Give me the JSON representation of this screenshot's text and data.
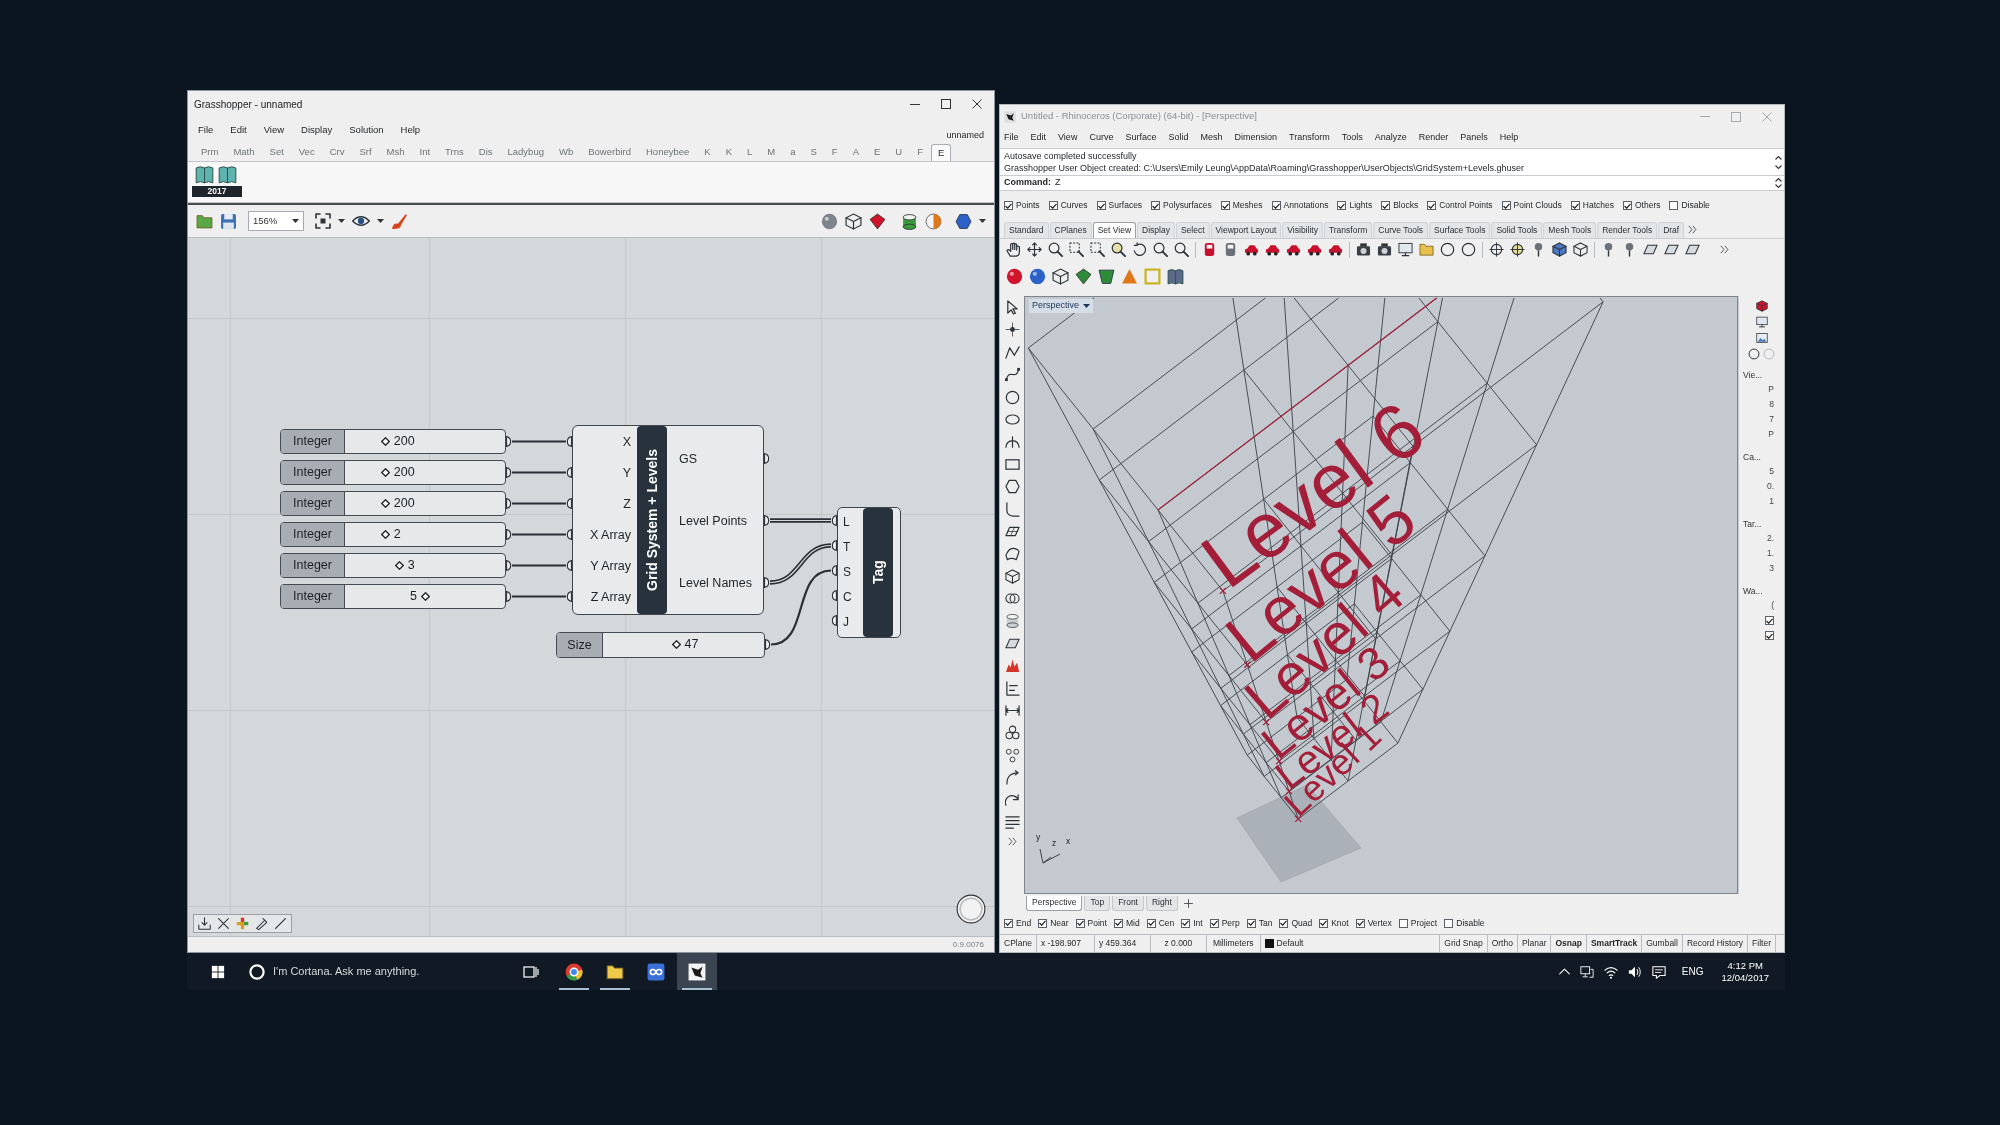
{
  "grasshopper": {
    "title": "Grasshopper - unnamed",
    "active": true,
    "menu": [
      "File",
      "Edit",
      "View",
      "Display",
      "Solution",
      "Help"
    ],
    "document": "unnamed",
    "tabs": [
      {
        "label": "Prm",
        "selected": false
      },
      {
        "label": "Math",
        "selected": false
      },
      {
        "label": "Set",
        "selected": false
      },
      {
        "label": "Vec",
        "selected": false
      },
      {
        "label": "Crv",
        "selected": false
      },
      {
        "label": "Srf",
        "selected": false
      },
      {
        "label": "Msh",
        "selected": false
      },
      {
        "label": "Int",
        "selected": false
      },
      {
        "label": "Trns",
        "selected": false
      },
      {
        "label": "Dis",
        "selected": false
      },
      {
        "label": "Ladybug",
        "selected": false
      },
      {
        "label": "Wb",
        "selected": false
      },
      {
        "label": "Bowerbird",
        "selected": false
      },
      {
        "label": "Honeybee",
        "selected": false
      },
      {
        "label": "K",
        "selected": false
      },
      {
        "label": "K",
        "selected": false
      },
      {
        "label": "L",
        "selected": false
      },
      {
        "label": "M",
        "selected": false
      },
      {
        "label": "a",
        "selected": false
      },
      {
        "label": "S",
        "selected": false
      },
      {
        "label": "F",
        "selected": false
      },
      {
        "label": "A",
        "selected": false
      },
      {
        "label": "E",
        "selected": false
      },
      {
        "label": "U",
        "selected": false
      },
      {
        "label": "F",
        "selected": false
      },
      {
        "label": "E",
        "selected": true
      }
    ],
    "ribbon_badge": "2017",
    "zoom": "156%",
    "sliders": [
      {
        "label": "Integer",
        "value": "200",
        "level": 0.22
      },
      {
        "label": "Integer",
        "value": "200",
        "level": 0.22
      },
      {
        "label": "Integer",
        "value": "200",
        "level": 0.22
      },
      {
        "label": "Integer",
        "value": "2",
        "level": 0.22
      },
      {
        "label": "Integer",
        "value": "3",
        "level": 0.32
      },
      {
        "label": "Integer",
        "value": "5",
        "level": 0.5
      }
    ],
    "component": {
      "title": "Grid System + Levels",
      "inputs": [
        "X",
        "Y",
        "Z",
        "X Array",
        "Y Array",
        "Z Array"
      ],
      "outputs": [
        "GS",
        "Level Points",
        "Level Names"
      ]
    },
    "size_slider": {
      "label": "Size",
      "value": "47",
      "level": 0.45
    },
    "tag": {
      "title": "Tag",
      "inputs": [
        "L",
        "T",
        "S",
        "C",
        "J"
      ]
    },
    "version": "0.9.0076"
  },
  "rhino": {
    "title": "Untitled - Rhinoceros (Corporate) (64-bit) - [Perspective]",
    "active": false,
    "menu": [
      "File",
      "Edit",
      "View",
      "Curve",
      "Surface",
      "Solid",
      "Mesh",
      "Dimension",
      "Transform",
      "Tools",
      "Analyze",
      "Render",
      "Panels",
      "Help"
    ],
    "history": [
      "Autosave completed successfully",
      "Grasshopper User Object created: C:\\Users\\Emily Leung\\AppData\\Roaming\\Grasshopper\\UserObjects\\GridSystem+Levels.ghuser"
    ],
    "command": {
      "label": "Command:",
      "value": "Z"
    },
    "filters": [
      {
        "label": "Points",
        "checked": true
      },
      {
        "label": "Curves",
        "checked": true
      },
      {
        "label": "Surfaces",
        "checked": true
      },
      {
        "label": "Polysurfaces",
        "checked": true
      },
      {
        "label": "Meshes",
        "checked": true
      },
      {
        "label": "Annotations",
        "checked": true
      },
      {
        "label": "Lights",
        "checked": true
      },
      {
        "label": "Blocks",
        "checked": true
      },
      {
        "label": "Control Points",
        "checked": true
      },
      {
        "label": "Point Clouds",
        "checked": true
      },
      {
        "label": "Hatches",
        "checked": true
      },
      {
        "label": "Others",
        "checked": true
      },
      {
        "label": "Disable",
        "checked": false
      }
    ],
    "toolbar_tabs": [
      {
        "label": "Standard",
        "selected": false
      },
      {
        "label": "CPlanes",
        "selected": false
      },
      {
        "label": "Set View",
        "selected": true
      },
      {
        "label": "Display",
        "selected": false
      },
      {
        "label": "Select",
        "selected": false
      },
      {
        "label": "Viewport Layout",
        "selected": false
      },
      {
        "label": "Visibility",
        "selected": false
      },
      {
        "label": "Transform",
        "selected": false
      },
      {
        "label": "Curve Tools",
        "selected": false
      },
      {
        "label": "Surface Tools",
        "selected": false
      },
      {
        "label": "Solid Tools",
        "selected": false
      },
      {
        "label": "Mesh Tools",
        "selected": false
      },
      {
        "label": "Render Tools",
        "selected": false
      },
      {
        "label": "Draf",
        "selected": false
      }
    ],
    "viewport": {
      "label": "Perspective",
      "levels": [
        "Level 6",
        "Level 5",
        "Level 4",
        "Level 3",
        "Level 2",
        "Level 1"
      ],
      "axes": [
        "y",
        "z",
        "x"
      ]
    },
    "properties_panel": [
      {
        "label": "Vie...",
        "values": [
          "P",
          "8",
          "7",
          "P"
        ]
      },
      {
        "label": "Ca...",
        "values": [
          "5",
          "0.",
          "1"
        ]
      },
      {
        "label": "Tar...",
        "values": [
          "2.",
          "1.",
          "3"
        ]
      },
      {
        "label": "Wa...",
        "values": [
          "("
        ],
        "checks": [
          true,
          true
        ]
      }
    ],
    "viewport_tabs": [
      {
        "label": "Perspective",
        "selected": true
      },
      {
        "label": "Top",
        "selected": false
      },
      {
        "label": "Front",
        "selected": false
      },
      {
        "label": "Right",
        "selected": false
      }
    ],
    "osnaps": [
      {
        "label": "End",
        "checked": true
      },
      {
        "label": "Near",
        "checked": true
      },
      {
        "label": "Point",
        "checked": true
      },
      {
        "label": "Mid",
        "checked": true
      },
      {
        "label": "Cen",
        "checked": true
      },
      {
        "label": "Int",
        "checked": true
      },
      {
        "label": "Perp",
        "checked": true
      },
      {
        "label": "Tan",
        "checked": true
      },
      {
        "label": "Quad",
        "checked": true
      },
      {
        "label": "Knot",
        "checked": true
      },
      {
        "label": "Vertex",
        "checked": true
      },
      {
        "label": "Project",
        "checked": false
      },
      {
        "label": "Disable",
        "checked": false
      }
    ],
    "status": {
      "cplane": "CPlane",
      "x": "x -198.907",
      "y": "y 459.364",
      "z": "z 0.000",
      "units": "Millimeters",
      "layer": "Default",
      "toggles": [
        {
          "label": "Grid Snap",
          "on": false
        },
        {
          "label": "Ortho",
          "on": false
        },
        {
          "label": "Planar",
          "on": false
        },
        {
          "label": "Osnap",
          "on": true
        },
        {
          "label": "SmartTrack",
          "on": true
        },
        {
          "label": "Gumball",
          "on": false
        },
        {
          "label": "Record History",
          "on": false
        },
        {
          "label": "Filter",
          "on": false
        }
      ]
    }
  },
  "taskbar": {
    "search": {
      "placeholder": "I'm Cortana. Ask me anything."
    },
    "apps": [
      {
        "kind": "browser",
        "running": true,
        "selected": false
      },
      {
        "kind": "folder",
        "running": true,
        "selected": false
      },
      {
        "kind": "loop",
        "running": false,
        "selected": false
      },
      {
        "kind": "modeler",
        "running": true,
        "selected": true
      }
    ],
    "language": "ENG",
    "time": "4:12 PM",
    "date": "12/04/2017"
  }
}
